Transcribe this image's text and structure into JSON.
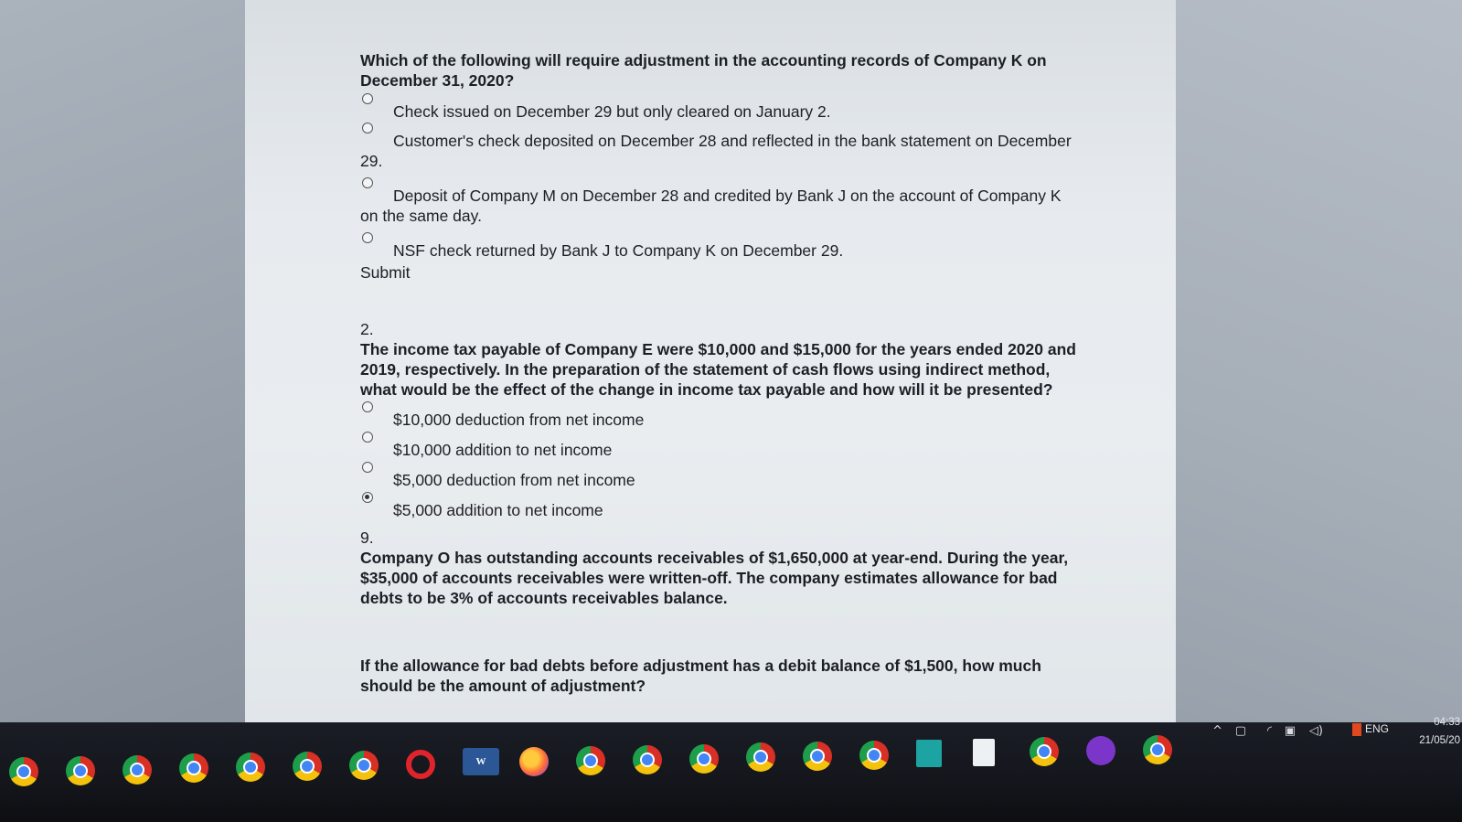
{
  "quiz": {
    "q1": {
      "question": "Which of the following will require adjustment in the accounting records of Company K on December 31, 2020?",
      "options": [
        "Check issued on December 29 but only cleared on January 2.",
        "Customer's check deposited on December 28 and reflected in the bank statement on December 29.",
        "Deposit of Company M on December 28 and credited by Bank J on the account of Company K on the same day.",
        "NSF check returned by Bank J to Company K on December 29."
      ],
      "submit_label": "Submit"
    },
    "q2": {
      "number": "2.",
      "question": "The income tax payable of Company E were $10,000 and $15,000 for the years ended 2020 and 2019, respectively. In the preparation of the statement of cash flows using indirect method, what would be the effect of the change in income tax payable and how will it be presented?",
      "options": [
        "$10,000 deduction from net income",
        "$10,000 addition to net income",
        "$5,000 deduction from net income",
        "$5,000 addition to net income"
      ],
      "selected_index": 3
    },
    "q9": {
      "number": "9.",
      "question": "Company O has outstanding accounts receivables of $1,650,000 at year-end. During the year, $35,000 of accounts receivables were written-off. The company estimates allowance for bad debts to be 3% of accounts receivables balance.",
      "followup": "If the allowance for bad debts before adjustment has a debit balance of $1,500, how much should be the amount of adjustment?"
    }
  },
  "taskbar": {
    "icons": [
      "chrome-icon",
      "chrome-icon",
      "chrome-icon",
      "chrome-icon",
      "chrome-icon",
      "chrome-icon",
      "chrome-icon",
      "opera-icon",
      "word-icon",
      "firefox-icon",
      "chrome-icon",
      "chrome-icon",
      "chrome-icon",
      "chrome-icon",
      "chrome-icon",
      "chrome-icon",
      "sublime-icon",
      "file-icon",
      "chrome-icon",
      "purple-app-icon",
      "chrome-icon"
    ],
    "word_letter": "W",
    "tray": {
      "language": "ENG",
      "time": "04:33",
      "date": "21/05/20"
    }
  },
  "colors": {
    "page_bg": "#e7ebef",
    "taskbar_bg": "#14161c",
    "text": "#1d1f26"
  }
}
